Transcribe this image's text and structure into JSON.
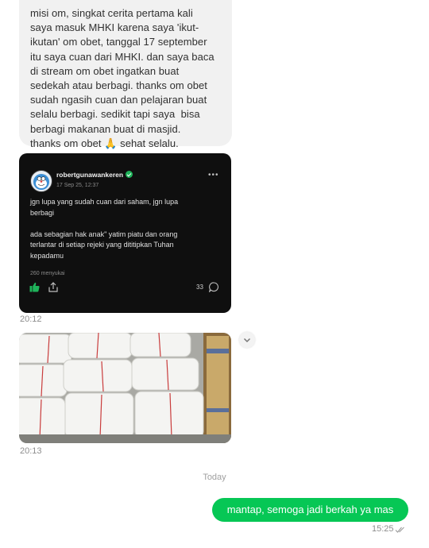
{
  "incoming_message": {
    "text": "misi om, singkat cerita pertama kali\nsaya masuk MHKI karena saya 'ikut-\nikutan' om obet, tanggal 17 september\nitu saya cuan dari MHKI. dan saya baca\ndi stream om obet ingatkan buat\nsedekah atau berbagi. thanks om obet\nsudah ngasih cuan dan pelajaran buat\nselalu berbagi. sedikit tapi saya  bisa\nberbagi makanan buat di masjid.\nthanks om obet 🙏 sehat selalu."
  },
  "post_card": {
    "username": "robertgunawankeren",
    "date": "17 Sep 25, 12:37",
    "more": "•••",
    "body": "jgn lupa yang sudah cuan dari saham, jgn lupa\nberbagi\n\nada sebagian hak anak\" yatim piatu dan orang\nterlantar di setiap rejeki yang dititipkan Tuhan\nkepadamu",
    "likes": "260 menyukai",
    "comment_count": "33",
    "accent_color": "#1fb35a"
  },
  "message_times": {
    "post": "20:12",
    "photo": "20:13"
  },
  "photo": {
    "icon": "food-boxes-photo"
  },
  "day_separator": "Today",
  "outgoing_message": {
    "text": "mantap, semoga jadi berkah ya mas",
    "time": "15:25",
    "bubble_color": "#06c755"
  }
}
